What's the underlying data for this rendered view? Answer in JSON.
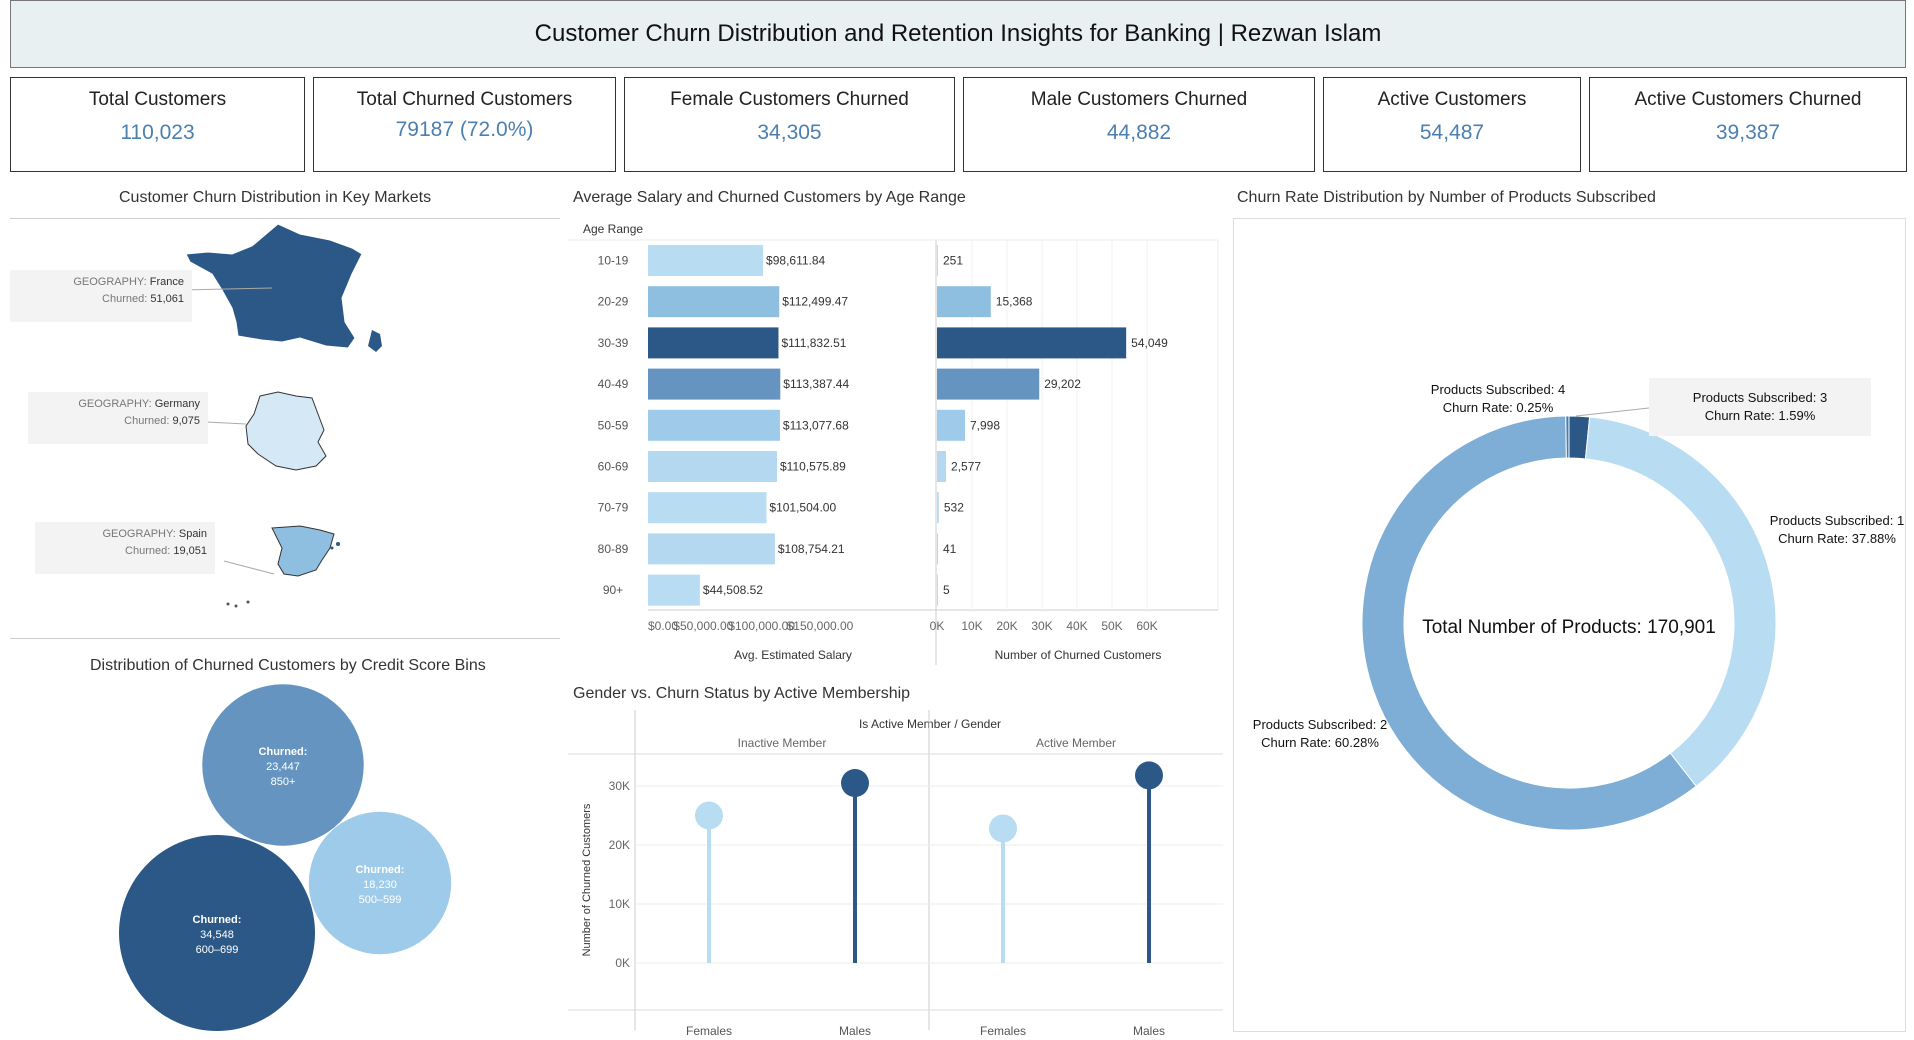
{
  "title": "Customer Churn Distribution and Retention Insights for Banking | Rezwan Islam",
  "kpis": [
    {
      "label": "Total Customers",
      "value": "110,023"
    },
    {
      "label": "Total Churned Customers",
      "value": "79187 (72.0%)"
    },
    {
      "label": "Female Customers Churned",
      "value": "34,305"
    },
    {
      "label": "Male Customers Churned",
      "value": "44,882"
    },
    {
      "label": "Active Customers",
      "value": "54,487"
    },
    {
      "label": "Active Customers Churned",
      "value": "39,387"
    }
  ],
  "map": {
    "title": "Customer Churn Distribution in Key Markets",
    "geo_label": "GEOGRAPHY:",
    "churned_label": "Churned:",
    "markets": [
      {
        "country": "France",
        "churned": "51,061",
        "color": "#2b5887"
      },
      {
        "country": "Germany",
        "churned": "9,075",
        "color": "#d5e8f5"
      },
      {
        "country": "Spain",
        "churned": "19,051",
        "color": "#8fbfe0"
      }
    ]
  },
  "age_chart": {
    "title": "Average Salary and Churned Customers by Age Range",
    "row_header": "Age Range",
    "salary_axis_title": "Avg. Estimated Salary",
    "count_axis_title": "Number of Churned Customers",
    "salary_ticks": [
      "$0.00",
      "$50,000.00",
      "$100,000.00",
      "$150,000.00"
    ],
    "count_ticks": [
      "0K",
      "10K",
      "20K",
      "30K",
      "40K",
      "50K",
      "60K"
    ]
  },
  "bubbles": {
    "title": "Distribution of Churned Customers by Credit Score Bins",
    "label": "Churned:"
  },
  "gender_chart": {
    "title": "Gender vs. Churn Status by Active Membership",
    "header": "Is Active Member / Gender",
    "panels": [
      "Inactive Member",
      "Active Member"
    ],
    "genders": [
      "Females",
      "Males"
    ],
    "y_axis_title": "Number of Churned Customers",
    "y_ticks": [
      "0K",
      "10K",
      "20K",
      "30K"
    ]
  },
  "donut": {
    "title": "Churn Rate Distribution by Number of Products Subscribed",
    "center_label": "Total Number of Products: 170,901",
    "prefix": "Products Subscribed:",
    "rate_prefix": "Churn Rate:"
  },
  "colors": {
    "dark": "#2b5887",
    "mid": "#6494bf",
    "light": "#8fbfe0",
    "pale": "#b8dcf2",
    "kpi_value": "#4b7fb0"
  },
  "chart_data": [
    {
      "type": "bar",
      "title": "Average Salary and Churned Customers by Age Range",
      "categories": [
        "10-19",
        "20-29",
        "30-39",
        "40-49",
        "50-59",
        "60-69",
        "70-79",
        "80-89",
        "90+"
      ],
      "series": [
        {
          "name": "Avg. Estimated Salary",
          "values": [
            98611.84,
            112499.47,
            111832.51,
            113387.44,
            113077.68,
            110575.89,
            101504.0,
            108754.21,
            44508.52
          ],
          "labels": [
            "$98,611.84",
            "$112,499.47",
            "$111,832.51",
            "$113,387.44",
            "$113,077.68",
            "$110,575.89",
            "$101,504.00",
            "$108,754.21",
            "$44,508.52"
          ]
        },
        {
          "name": "Number of Churned Customers",
          "values": [
            251,
            15368,
            54049,
            29202,
            7998,
            2577,
            532,
            41,
            5
          ],
          "labels": [
            "251",
            "15,368",
            "54,049",
            "29,202",
            "7,998",
            "2,577",
            "532",
            "41",
            "5"
          ]
        }
      ],
      "bar_colors": [
        "#b8dcf2",
        "#8fbfe0",
        "#2b5887",
        "#6494bf",
        "#9ecbea",
        "#b3d8f0",
        "#b8dcf2",
        "#b3d8f0",
        "#b8dcf2"
      ],
      "xlim_salary": [
        0,
        150000
      ],
      "xlim_count": [
        0,
        60000
      ]
    },
    {
      "type": "bubble",
      "title": "Distribution of Churned Customers by Credit Score Bins",
      "bins": [
        {
          "bin": "850+",
          "churned": 23447,
          "label": "23,447",
          "color": "#6494bf"
        },
        {
          "bin": "500-599",
          "churned": 18230,
          "label": "18,230",
          "color": "#9ecbea"
        },
        {
          "bin": "600-699",
          "churned": 34548,
          "label": "34,548",
          "color": "#2b5887"
        }
      ]
    },
    {
      "type": "lollipop",
      "title": "Gender vs. Churn Status by Active Membership",
      "ylim": [
        0,
        30000
      ],
      "panels": [
        {
          "name": "Inactive Member",
          "values": {
            "Females": 25000,
            "Males": 30500
          }
        },
        {
          "name": "Active Member",
          "values": {
            "Females": 22800,
            "Males": 31800
          }
        }
      ],
      "colors": {
        "Females": "#b8dcf2",
        "Males": "#2b5887"
      }
    },
    {
      "type": "pie",
      "title": "Churn Rate Distribution by Number of Products Subscribed",
      "slices": [
        {
          "products": 1,
          "churn_rate": 37.88,
          "label": "Products Subscribed: 1",
          "rate_label": "Churn Rate: 37.88%",
          "color": "#b8dcf2"
        },
        {
          "products": 2,
          "churn_rate": 60.28,
          "label": "Products Subscribed: 2",
          "rate_label": "Churn Rate: 60.28%",
          "color": "#7eadd6"
        },
        {
          "products": 3,
          "churn_rate": 1.59,
          "label": "Products Subscribed: 3",
          "rate_label": "Churn Rate: 1.59%",
          "color": "#2b5887"
        },
        {
          "products": 4,
          "churn_rate": 0.25,
          "label": "Products Subscribed: 4",
          "rate_label": "Churn Rate: 0.25%",
          "color": "#4a7cb0"
        }
      ]
    }
  ]
}
